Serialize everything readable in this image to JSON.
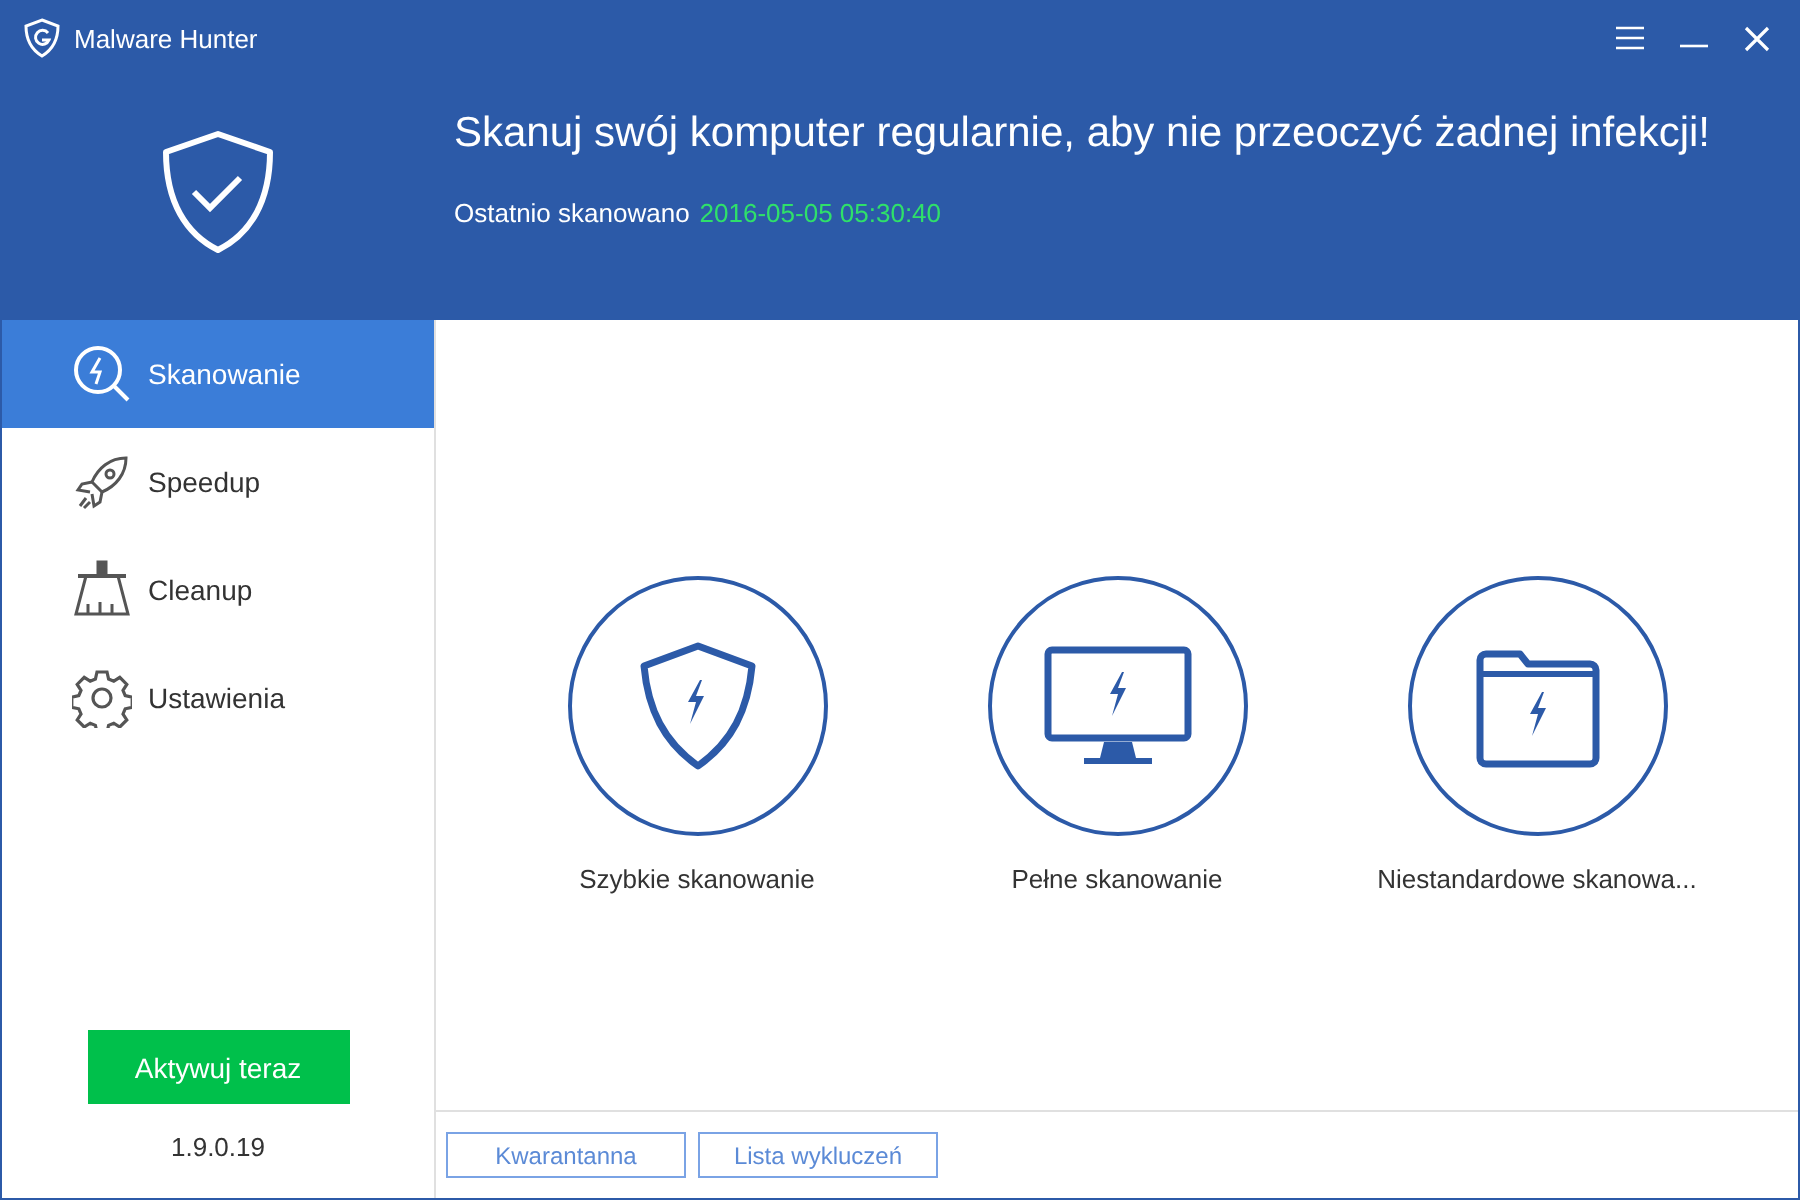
{
  "window": {
    "title": "Malware Hunter"
  },
  "header": {
    "headline": "Skanuj swój komputer regularnie, aby nie przeoczyć żadnej infekcji!",
    "last_scan_label": "Ostatnio skanowano",
    "last_scan_time": "2016-05-05 05:30:40"
  },
  "sidebar": {
    "items": [
      {
        "label": "Skanowanie",
        "kind": "scan",
        "selected": true
      },
      {
        "label": "Speedup",
        "kind": "rocket",
        "selected": false
      },
      {
        "label": "Cleanup",
        "kind": "broom",
        "selected": false
      },
      {
        "label": "Ustawienia",
        "kind": "gear",
        "selected": false
      }
    ],
    "activate_button": "Aktywuj teraz",
    "version": "1.9.0.19"
  },
  "scan_options": [
    {
      "label": "Szybkie skanowanie",
      "kind": "shield"
    },
    {
      "label": "Pełne skanowanie",
      "kind": "monitor"
    },
    {
      "label": "Niestandardowe skanowa...",
      "kind": "folder"
    }
  ],
  "footer_buttons": [
    "Kwarantanna",
    "Lista wykluczeń"
  ]
}
